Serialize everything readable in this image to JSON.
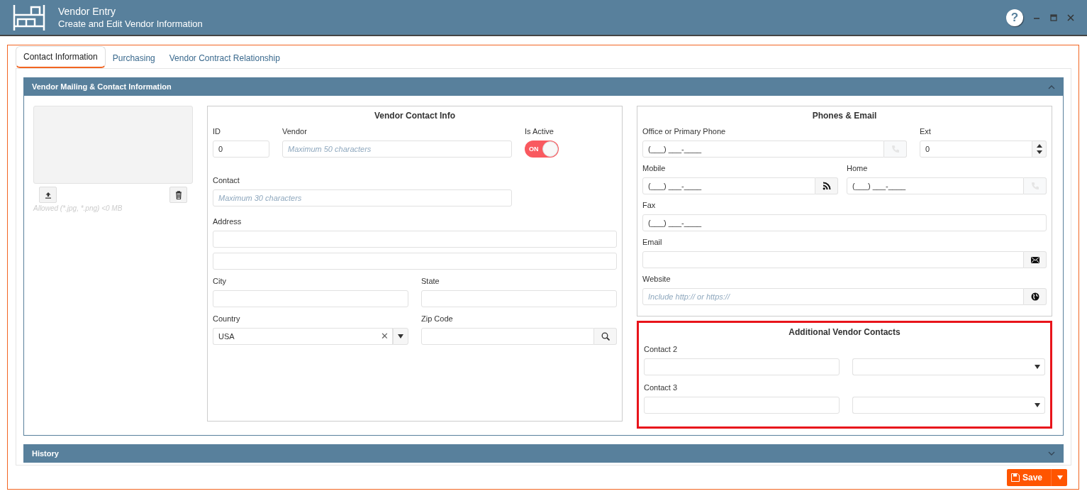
{
  "header": {
    "title": "Vendor Entry",
    "subtitle": "Create and Edit Vendor Information",
    "help": "?"
  },
  "tabs": [
    {
      "label": "Contact Information",
      "selected": true
    },
    {
      "label": "Purchasing",
      "selected": false
    },
    {
      "label": "Vendor Contract Relationship",
      "selected": false
    }
  ],
  "panel": {
    "title": "Vendor Mailing & Contact Information",
    "expanded": true
  },
  "image_upload": {
    "hint": "Allowed (*.jpg, *.png) <0 MB"
  },
  "contact_info": {
    "title": "Vendor Contact Info",
    "id": {
      "label": "ID",
      "value": "0"
    },
    "vendor": {
      "label": "Vendor",
      "placeholder": "Maximum 50 characters"
    },
    "is_active": {
      "label": "Is Active",
      "on": true,
      "text": "ON"
    },
    "contact": {
      "label": "Contact",
      "placeholder": "Maximum 30 characters"
    },
    "address": {
      "label": "Address"
    },
    "city": {
      "label": "City"
    },
    "state": {
      "label": "State"
    },
    "country": {
      "label": "Country",
      "value": "USA",
      "clear": "✕"
    },
    "zip": {
      "label": "Zip Code"
    }
  },
  "phones": {
    "title": "Phones & Email",
    "office": {
      "label": "Office or Primary Phone",
      "value": "(___) ___-____",
      "kind": "call",
      "disabled": true
    },
    "ext": {
      "label": "Ext",
      "value": "0"
    },
    "mobile": {
      "label": "Mobile",
      "value": "(___) ___-____",
      "kind": "sms",
      "disabled": false
    },
    "home": {
      "label": "Home",
      "value": "(___) ___-____",
      "kind": "call",
      "disabled": true
    },
    "fax": {
      "label": "Fax",
      "value": "(___) ___-____"
    },
    "email": {
      "label": "Email"
    },
    "website": {
      "label": "Website",
      "placeholder": "Include http:// or https://"
    }
  },
  "additional": {
    "title": "Additional Vendor Contacts",
    "highlighted": true,
    "contacts": [
      {
        "label": "Contact 2"
      },
      {
        "label": "Contact 3"
      }
    ]
  },
  "history": {
    "title": "History",
    "expanded": false
  },
  "save": {
    "label": "Save"
  }
}
